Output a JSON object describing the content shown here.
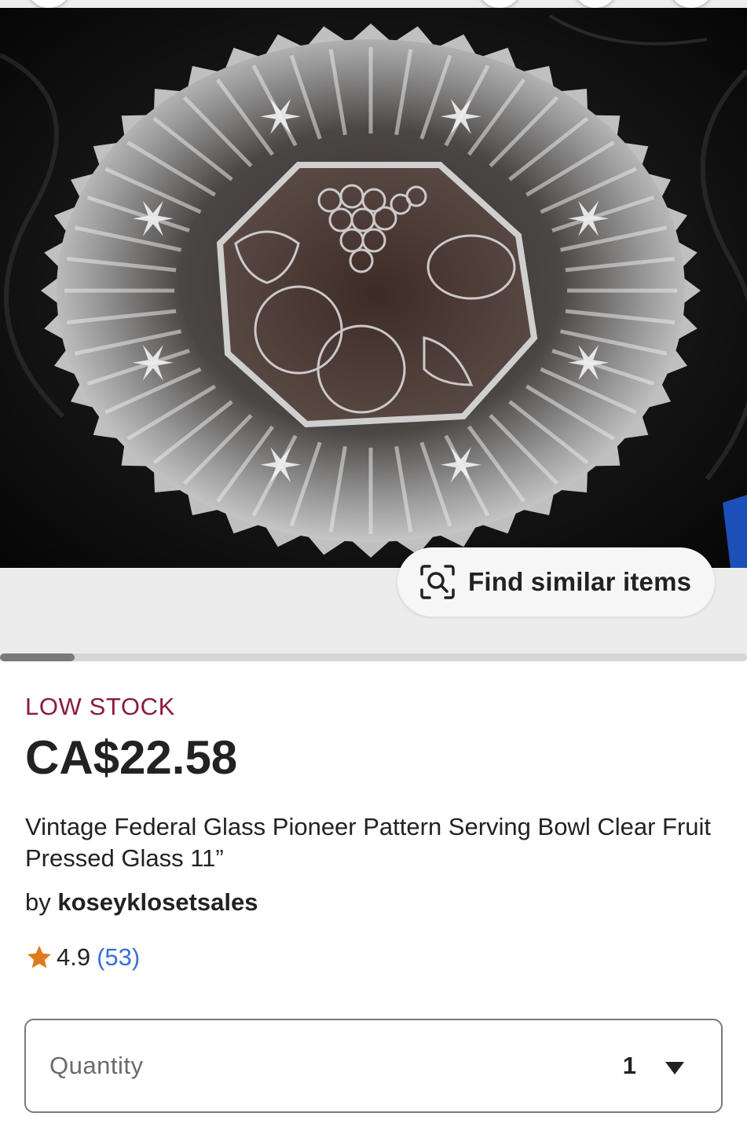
{
  "listing": {
    "image": {
      "description_icon": "glass-bowl-photo",
      "find_similar_label": "Find similar items",
      "find_similar_icon": "visual-search-icon",
      "gallery_position": 0.1
    },
    "stock_status": "LOW STOCK",
    "price": "CA$22.58",
    "title": "Vintage Federal Glass Pioneer Pattern Serving Bowl Clear Fruit Pressed Glass 11”",
    "seller_prefix": "by",
    "seller_name": "koseyklosetsales",
    "rating_value": "4.9",
    "review_count": "(53)",
    "quantity": {
      "label": "Quantity",
      "selected": "1"
    }
  },
  "colors": {
    "low_stock": "#8b1a3f",
    "review_link": "#3a6fd8",
    "star": "#e07b1a"
  }
}
